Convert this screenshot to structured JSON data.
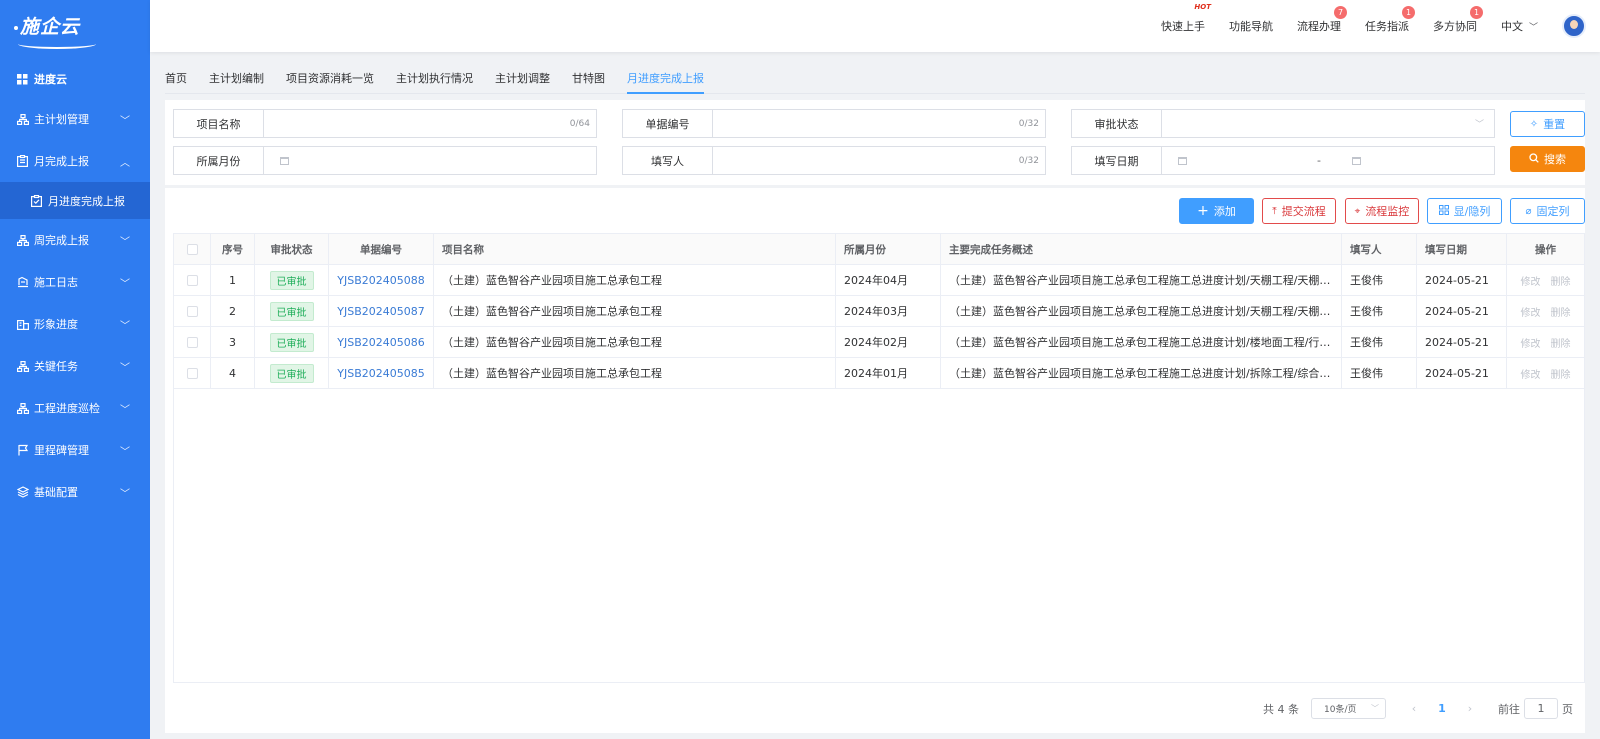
{
  "app": {
    "logo_text": "施企云",
    "accent_color": "#2f7cf0"
  },
  "sidebar": {
    "items": [
      {
        "label": "进度云",
        "icon": "grid-icon"
      },
      {
        "label": "主计划管理",
        "icon": "org-chart-icon",
        "expanded": false
      },
      {
        "label": "月完成上报",
        "icon": "clipboard-icon",
        "expanded": true
      },
      {
        "label": "月进度完成上报",
        "icon": "clipboard-check-icon",
        "active": true
      },
      {
        "label": "周完成上报",
        "icon": "org-chart-icon",
        "expanded": false
      },
      {
        "label": "施工日志",
        "icon": "notebook-icon",
        "expanded": false
      },
      {
        "label": "形象进度",
        "icon": "buildings-icon",
        "expanded": false
      },
      {
        "label": "关键任务",
        "icon": "org-chart-icon",
        "expanded": false
      },
      {
        "label": "工程进度巡检",
        "icon": "org-chart-icon",
        "expanded": false
      },
      {
        "label": "里程碑管理",
        "icon": "flag-icon",
        "expanded": false
      },
      {
        "label": "基础配置",
        "icon": "layers-icon",
        "expanded": false
      }
    ]
  },
  "header": {
    "quick_start": "快速上手",
    "hot_label": "HOT",
    "function_nav": "功能导航",
    "process": "流程办理",
    "process_badge": "7",
    "task": "任务指派",
    "task_badge": "1",
    "collab": "多方协同",
    "collab_badge": "1",
    "language": "中文"
  },
  "tabs": [
    {
      "label": "首页",
      "active": false
    },
    {
      "label": "主计划编制",
      "active": false
    },
    {
      "label": "项目资源消耗一览",
      "active": false
    },
    {
      "label": "主计划执行情况",
      "active": false
    },
    {
      "label": "主计划调整",
      "active": false
    },
    {
      "label": "甘特图",
      "active": false
    },
    {
      "label": "月进度完成上报",
      "active": true
    }
  ],
  "filters": {
    "project_name": {
      "label": "项目名称",
      "value": "",
      "count": "0/64"
    },
    "doc_no": {
      "label": "单据编号",
      "value": "",
      "count": "0/32"
    },
    "approval_status": {
      "label": "审批状态",
      "value": ""
    },
    "month": {
      "label": "所属月份",
      "value": ""
    },
    "filler": {
      "label": "填写人",
      "value": "",
      "count": "0/32"
    },
    "fill_date": {
      "label": "填写日期",
      "separator": "-"
    },
    "reset": "重置",
    "search": "搜索"
  },
  "toolbar": {
    "add": "添加",
    "submit": "提交流程",
    "monitor": "流程监控",
    "toggle_cols": "显/隐列",
    "fix_cols": "固定列"
  },
  "table": {
    "headers": {
      "no": "序号",
      "status": "审批状态",
      "code": "单据编号",
      "project": "项目名称",
      "month": "所属月份",
      "desc": "主要完成任务概述",
      "user": "填写人",
      "date": "填写日期",
      "ops": "操作"
    },
    "rows": [
      {
        "no": "1",
        "status": "已审批",
        "code": "YJSB202405088",
        "project": "（土建）蓝色智谷产业园项目施工总承包工程",
        "month": "2024年04月",
        "desc": "（土建）蓝色智谷产业园项目施工总承包工程施工总进度计划/天棚工程/天棚喷漆...",
        "user": "王俊伟",
        "date": "2024-05-21",
        "edit": "修改",
        "del": "删除"
      },
      {
        "no": "2",
        "status": "已审批",
        "code": "YJSB202405087",
        "project": "（土建）蓝色智谷产业园项目施工总承包工程",
        "month": "2024年03月",
        "desc": "（土建）蓝色智谷产业园项目施工总承包工程施工总进度计划/天棚工程/天棚喷漆...",
        "user": "王俊伟",
        "date": "2024-05-21",
        "edit": "修改",
        "del": "删除"
      },
      {
        "no": "3",
        "status": "已审批",
        "code": "YJSB202405086",
        "project": "（土建）蓝色智谷产业园项目施工总承包工程",
        "month": "2024年02月",
        "desc": "（土建）蓝色智谷产业园项目施工总承包工程施工总进度计划/楼地面工程/行车通...",
        "user": "王俊伟",
        "date": "2024-05-21",
        "edit": "修改",
        "del": "删除"
      },
      {
        "no": "4",
        "status": "已审批",
        "code": "YJSB202405085",
        "project": "（土建）蓝色智谷产业园项目施工总承包工程",
        "month": "2024年01月",
        "desc": "（土建）蓝色智谷产业园项目施工总承包工程施工总进度计划/拆除工程/综合拆除 ...",
        "user": "王俊伟",
        "date": "2024-05-21",
        "edit": "修改",
        "del": "删除"
      }
    ]
  },
  "pagination": {
    "total": "共 4 条",
    "page_size": "10条/页",
    "prev": "‹",
    "current": "1",
    "next": "›",
    "goto": "前往",
    "goto_value": "1",
    "page_suffix": "页"
  }
}
